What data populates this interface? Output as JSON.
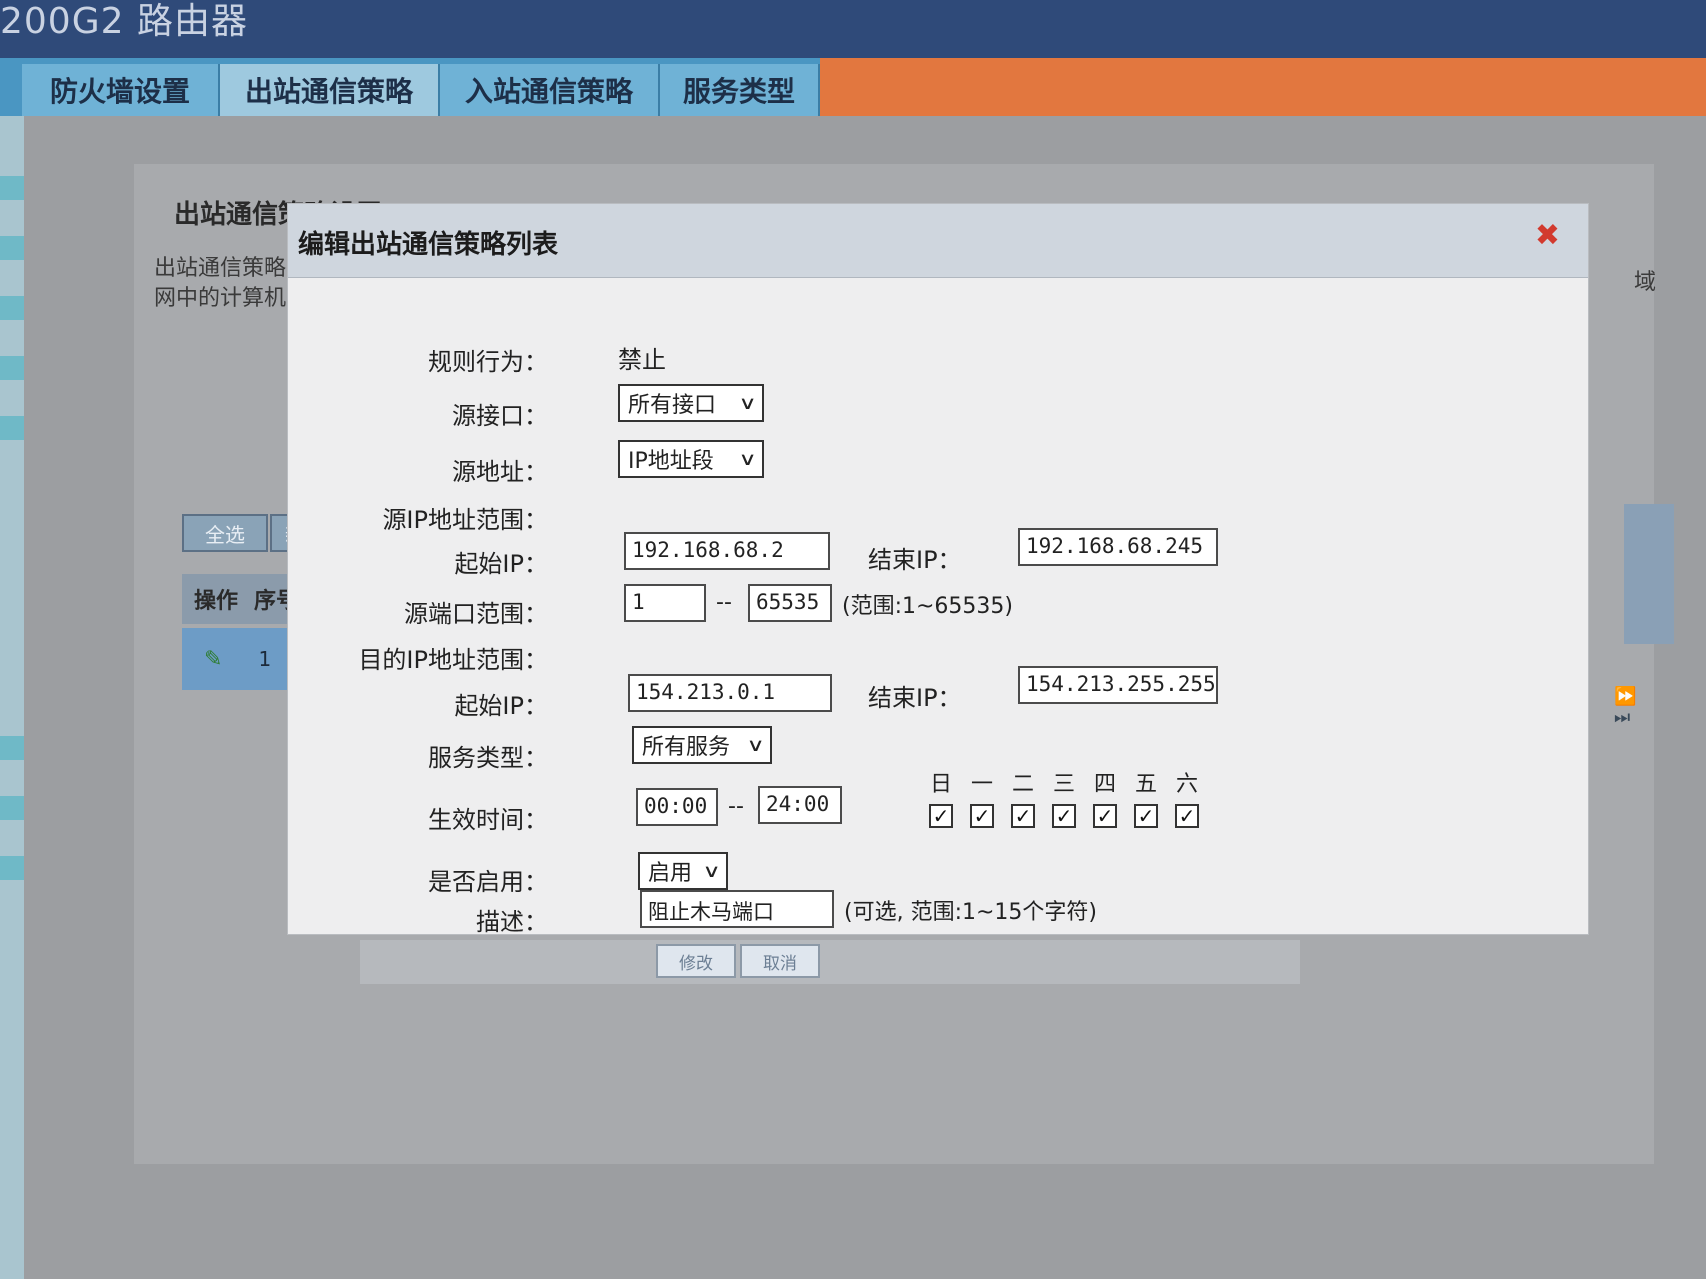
{
  "app": {
    "title": "200G2 路由器"
  },
  "tabs": [
    {
      "label": "防火墙设置"
    },
    {
      "label": "出站通信策略"
    },
    {
      "label": "入站通信策略"
    },
    {
      "label": "服务类型"
    }
  ],
  "background": {
    "panel_title": "出站通信策略设置",
    "desc_line1": "出站通信策略",
    "desc_line2": "网中的计算机",
    "btn_select_all": "全选",
    "btn_new": "新",
    "col_op": "操作",
    "col_seq": "序号",
    "row_seq": "1",
    "right_label": "域"
  },
  "dialog": {
    "title": "编辑出站通信策略列表",
    "rule_action_label": "规则行为：",
    "rule_action_value": "禁止",
    "src_iface_label": "源接口：",
    "src_iface_value": "所有接口",
    "src_addr_label": "源地址：",
    "src_addr_value": "IP地址段",
    "src_ip_range_label": "源IP地址范围：",
    "start_ip_label": "起始IP：",
    "src_start_ip": "192.168.68.2",
    "end_ip_label": "结束IP：",
    "src_end_ip": "192.168.68.245",
    "src_port_label": "源端口范围：",
    "src_port_start": "1",
    "src_port_end": "65535",
    "port_dash": "--",
    "port_hint": "(范围:1~65535)",
    "dst_ip_range_label": "目的IP地址范围：",
    "dst_start_ip": "154.213.0.1",
    "dst_end_ip": "154.213.255.255",
    "service_label": "服务类型：",
    "service_value": "所有服务",
    "time_label": "生效时间：",
    "time_start": "00:00",
    "time_end": "24:00",
    "time_dash": "--",
    "days": [
      "日",
      "一",
      "二",
      "三",
      "四",
      "五",
      "六"
    ],
    "enable_label": "是否启用：",
    "enable_value": "启用",
    "desc_label": "描述：",
    "desc_value": "阻止木马端口",
    "desc_hint": "(可选, 范围:1~15个字符)",
    "btn_modify": "修改",
    "btn_cancel": "取消"
  }
}
